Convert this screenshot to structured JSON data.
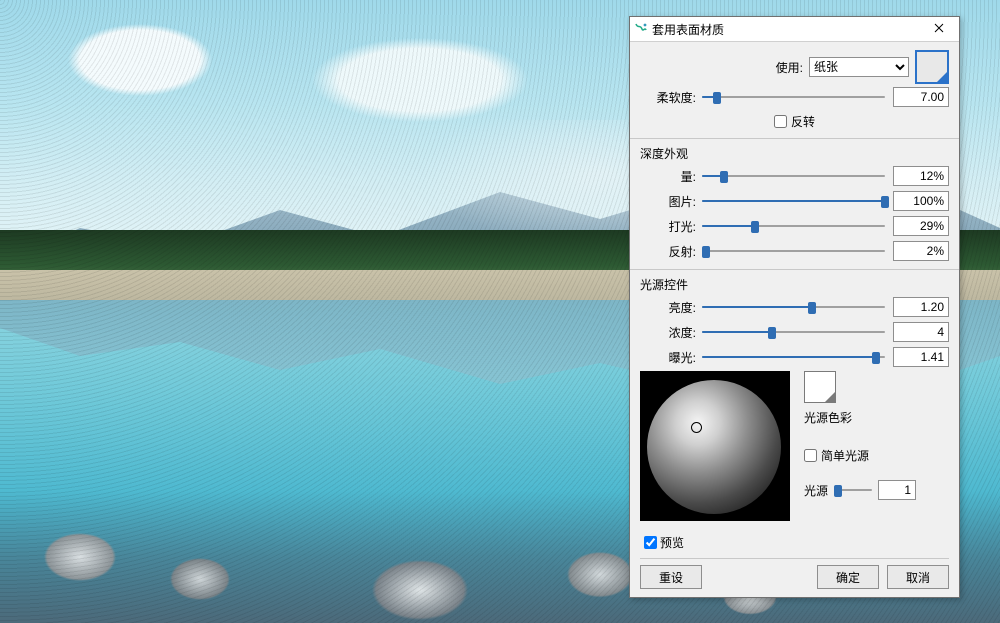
{
  "dialog": {
    "title": "套用表面材质",
    "use_label": "使用:",
    "use_value": "纸张",
    "softness_label": "柔软度:",
    "softness_value": "7.00",
    "invert_label": "反转",
    "invert_checked": false,
    "depth_section": "深度外观",
    "amount_label": "量:",
    "amount_value": "12%",
    "picture_label": "图片:",
    "picture_value": "100%",
    "shine_label": "打光:",
    "shine_value": "29%",
    "reflect_label": "反射:",
    "reflect_value": "2%",
    "light_section": "光源控件",
    "brightness_label": "亮度:",
    "brightness_value": "1.20",
    "conc_label": "浓度:",
    "conc_value": "4",
    "exposure_label": "曝光:",
    "exposure_value": "1.41",
    "light_color_label": "光源色彩",
    "simple_label": "简单光源",
    "simple_checked": false,
    "light_count_label": "光源",
    "light_count_value": "1",
    "preview_label": "预览",
    "preview_checked": true,
    "reset_label": "重设",
    "ok_label": "确定",
    "cancel_label": "取消"
  },
  "sliders": {
    "softness_pct": 8,
    "amount_pct": 12,
    "picture_pct": 100,
    "shine_pct": 29,
    "reflect_pct": 2,
    "brightness_pct": 60,
    "conc_pct": 38,
    "exposure_pct": 95,
    "lightcount_pct": 10
  }
}
